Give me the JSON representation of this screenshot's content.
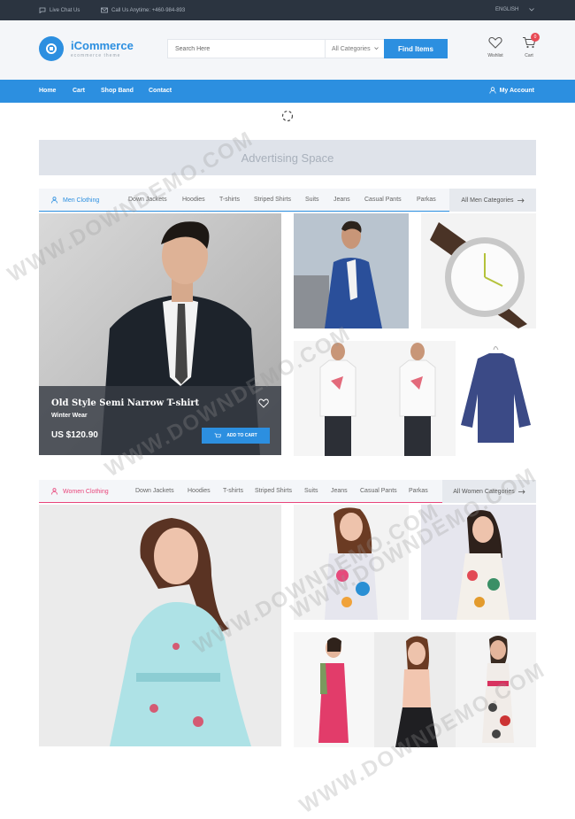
{
  "topbar": {
    "live_chat": "Live Chat Us",
    "call": "Call Us Anytime: +460-984-893",
    "language": "ENGLISH"
  },
  "header": {
    "brand": "iCommerce",
    "tagline": "ecommerce theme",
    "search_placeholder": "Search Here",
    "category_select": "All Categories",
    "search_button": "Find Items",
    "wishlist": "Wishlist",
    "cart": "Cart",
    "cart_count": "0"
  },
  "nav": {
    "items": [
      "Home",
      "Cart",
      "Shop Band",
      "Contact"
    ],
    "account": "My Account"
  },
  "ad": {
    "label": "Advertising Space"
  },
  "men": {
    "title": "Men Clothing",
    "links": [
      "Down Jackets",
      "Hoodies",
      "T-shirts",
      "Striped Shirts",
      "Suits",
      "Jeans",
      "Casual Pants",
      "Parkas"
    ],
    "all": "All Men Categories",
    "featured": {
      "title": "Old Style Semi Narrow T-shirt",
      "subtitle": "Winter Wear",
      "price": "US $120.90",
      "button": "ADD TO CART"
    }
  },
  "women": {
    "title": "Women Clothing",
    "links": [
      "Down Jackets",
      "Hoodies",
      "T-shirts",
      "Striped Shirts",
      "Suits",
      "Jeans",
      "Casual Pants",
      "Parkas"
    ],
    "all": "All Women Categories"
  },
  "watermark": "WWW.DOWNDEMO.COM",
  "colors": {
    "accent": "#2c8fe0",
    "women_accent": "#e8457b",
    "topbar": "#2b3440"
  }
}
